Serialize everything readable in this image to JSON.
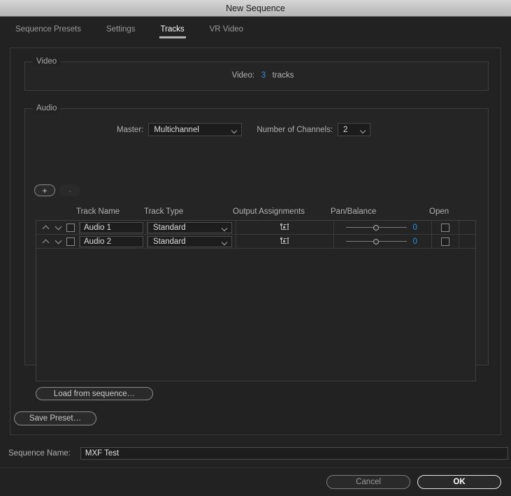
{
  "window": {
    "title": "New Sequence"
  },
  "tabs": [
    {
      "label": "Sequence Presets",
      "active": false
    },
    {
      "label": "Settings",
      "active": false
    },
    {
      "label": "Tracks",
      "active": true
    },
    {
      "label": "VR Video",
      "active": false
    }
  ],
  "video": {
    "group_label": "Video",
    "row_label": "Video:",
    "count": "3",
    "unit": "tracks"
  },
  "audio": {
    "group_label": "Audio",
    "master_label": "Master:",
    "master_value": "Multichannel",
    "channels_label": "Number of Channels:",
    "channels_value": "2",
    "add_button": "+",
    "remove_button": "-",
    "columns": {
      "track_name": "Track Name",
      "track_type": "Track Type",
      "output_assignments": "Output Assignments",
      "pan_balance": "Pan/Balance",
      "open": "Open"
    },
    "tracks": [
      {
        "name": "Audio 1",
        "type": "Standard",
        "output_icon": "routing-icon",
        "pan_value": "0",
        "open_checked": false,
        "selected": false
      },
      {
        "name": "Audio 2",
        "type": "Standard",
        "output_icon": "routing-icon",
        "pan_value": "0",
        "open_checked": false,
        "selected": false
      }
    ],
    "load_from_sequence": "Load from sequence…"
  },
  "footer": {
    "save_preset": "Save Preset…",
    "sequence_name_label": "Sequence Name:",
    "sequence_name_value": "MXF Test",
    "cancel": "Cancel",
    "ok": "OK"
  },
  "colors": {
    "accent_blue": "#2f8fe0",
    "dialog_bg": "#222222",
    "group_bg": "#252525",
    "titlebar_text": "#1b1b1b"
  }
}
